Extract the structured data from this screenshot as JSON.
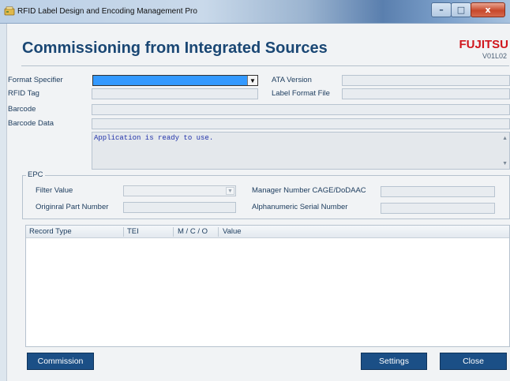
{
  "window": {
    "title": "RFID Label Design and Encoding Management Pro",
    "controls": {
      "minimize": "–",
      "maximize": "□",
      "close": "x"
    }
  },
  "header": {
    "title": "Commissioning from Integrated Sources",
    "brand": "FUJITSU",
    "version": "V01L02"
  },
  "form": {
    "format_specifier_label": "Format Specifier",
    "format_specifier_value": "",
    "ata_version_label": "ATA Version",
    "ata_version_value": "",
    "rfid_tag_label": "RFID Tag",
    "rfid_tag_value": "",
    "label_format_file_label": "Label Format File",
    "label_format_file_value": "",
    "barcode_label": "Barcode",
    "barcode_value": "",
    "barcode_data_label": "Barcode Data",
    "barcode_data_value": "",
    "message": "Application is ready to use."
  },
  "epc": {
    "legend": "EPC",
    "filter_value_label": "Filter Value",
    "filter_value": "",
    "manager_number_label": "Manager Number CAGE/DoDAAC",
    "manager_number_value": "",
    "part_number_label": "Originral Part Number",
    "part_number_value": "",
    "serial_number_label": "Alphanumeric Serial Number",
    "serial_number_value": ""
  },
  "table": {
    "columns": [
      "Record Type",
      "TEI",
      "M / C / O",
      "Value"
    ],
    "rows": []
  },
  "buttons": {
    "commission": "Commission",
    "settings": "Settings",
    "close": "Close"
  },
  "colors": {
    "accent": "#1b4f86",
    "brand": "#d0151c",
    "selection": "#3399ff"
  },
  "icons": {
    "app_icon": "rfid-app-icon",
    "dropdown": "chevron-down-icon"
  }
}
